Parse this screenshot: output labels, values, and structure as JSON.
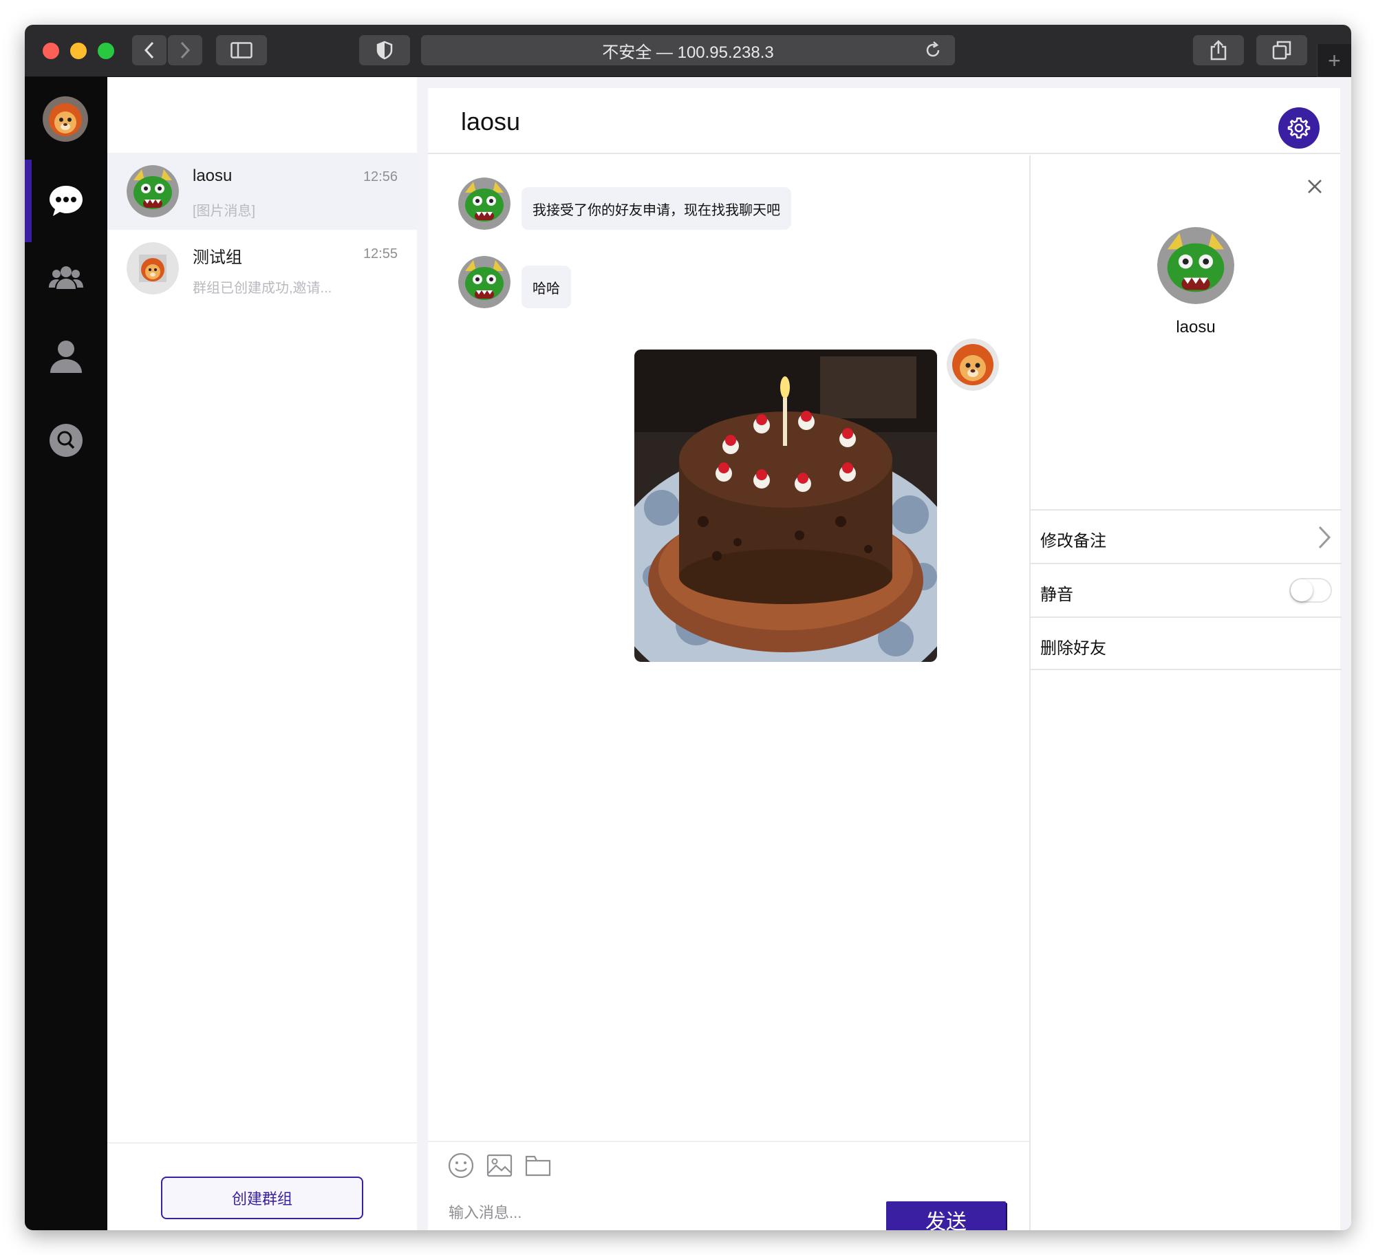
{
  "browser": {
    "url_text": "不安全 — 100.95.238.3"
  },
  "conversations": [
    {
      "name": "laosu",
      "time": "12:56",
      "preview": "[图片消息]"
    },
    {
      "name": "测试组",
      "time": "12:55",
      "preview": "群组已创建成功,邀请..."
    }
  ],
  "create_group_label": "创建群组",
  "chat": {
    "title": "laosu",
    "messages": [
      {
        "text": "我接受了你的好友申请，现在找我聊天吧"
      },
      {
        "text": "哈哈"
      }
    ],
    "input_placeholder": "输入消息...",
    "send_label": "发送"
  },
  "profile": {
    "name": "laosu",
    "rows": [
      {
        "label": "修改备注"
      },
      {
        "label": "静音"
      },
      {
        "label": "删除好友"
      }
    ],
    "mute_on": false
  },
  "colors": {
    "accent": "#3b1fa3",
    "nav_bg": "#0b0b0b",
    "bubble_bg": "#f1f1f8"
  }
}
